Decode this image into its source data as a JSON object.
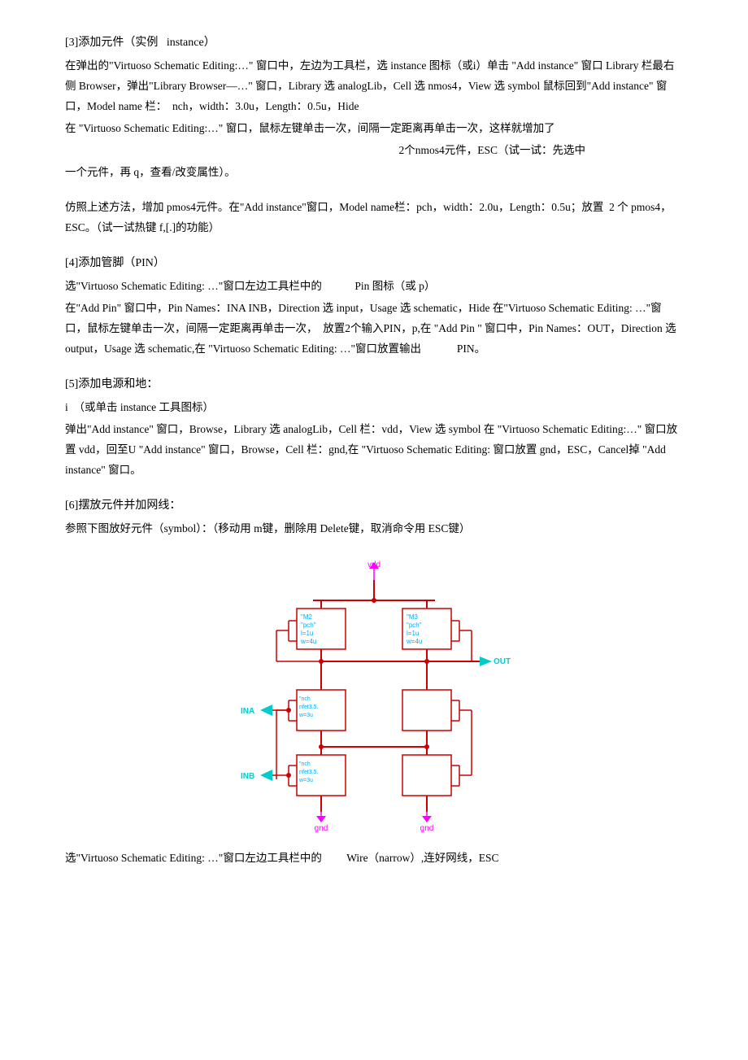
{
  "sections": [
    {
      "id": "s3",
      "title": "[3]添加元件（实例　instance）",
      "paragraphs": [
        "在弹出的\"Virtuoso Schematic Editing:…\" 窗口中，左边为工具栏，选 instance 图标（或i）单击 \"Add instance\" 窗口 Library 栏最右侧 Browser，弹出\"Library Browser—…\" 窗口，Library 选 analogLib，Cell 选 nmos4，View 选 symbol 鼠标回到\"Add instance\" 窗口，Model name 栏：　nch，width：3.0u，Length：0.5u，Hide 在 \"Virtuoso Schematic Editing:…\" 窗口，鼠标左键单击一次，间隔一定距离再单击一次，这样就增加了",
        "2个nmos4元件，ESC（试一试：先选中",
        "一个元件，再 q，查看/改变属性）。"
      ]
    },
    {
      "id": "s3b",
      "paragraphs": [
        "仿照上述方法，增加 pmos4元件。在\"Add instance\"窗口，Model name栏：pch，width：2.0u，Length：0.5u；放置  2 个 pmos4，ESC。（试一试热键 f,[.]的功能）"
      ]
    },
    {
      "id": "s4",
      "title": "[4]添加管脚（PIN）",
      "paragraphs": [
        "选\"Virtuoso Schematic Editing: …\"窗口左边工具栏中的　　　　　　Pin 图标（或 p）",
        "在\"Add Pin\" 窗口中，Pin Names：INA INB，Direction 选 input，Usage 选 schematic，Hide 在\"Virtuoso Schematic Editing: …\"窗口，鼠标左键单击一次，间隔一定距离再单击一次，　放置2个输入PIN，p,在 \"Add Pin \" 窗口中，Pin Names：OUT，Direction 选 output，Usage 选 schematic,在 \"Virtuoso Schematic Editing: …\"窗口放置输出　　　　　　PIN。"
      ]
    },
    {
      "id": "s5",
      "title": "[5]添加电源和地：",
      "paragraphs": [
        "i　（或单击 instance 工具图标）",
        "弹出\"Add instance\" 窗口，Browse，Library 选 analogLib，Cell 栏：vdd，View 选 symbol 在 \"Virtuoso Schematic Editing:…\" 窗口放置 vdd，回至U \"Add instance\" 窗口，Browse，Cell 栏：gnd,在 \"Virtuoso Schematic Editing: 窗口放置 gnd，ESC，Cancel掉 \"Add instance\" 窗口。"
      ]
    },
    {
      "id": "s6",
      "title": "[6]摆放元件并加网线：",
      "paragraphs": [
        "参照下图放好元件（symbol）：（移动用 m键，删除用 Delete键，取消命令用 ESC键）"
      ]
    },
    {
      "id": "s7",
      "paragraphs": [
        "选\"Virtuoso Schematic Editing: …\"窗口左边工具栏中的　　　　　Wire（narrow）,连好网线，ESC"
      ]
    }
  ]
}
